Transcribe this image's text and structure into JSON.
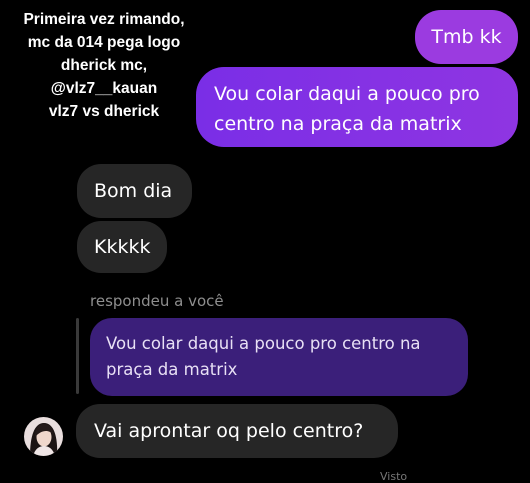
{
  "caption": {
    "lines": [
      "Primeira vez rimando,",
      "mc da 014 pega logo",
      "dherick mc,",
      "@vlz7__kauan",
      "vlz7 vs dherick"
    ]
  },
  "messages": {
    "outgoing": [
      {
        "text": "Tmb kk"
      },
      {
        "text_line1": "Vou colar daqui a pouco pro",
        "text_line2": "centro na praça da matrix"
      }
    ],
    "incoming": [
      {
        "text": "Bom dia"
      },
      {
        "text": "Kkkkk"
      },
      {
        "text": "Vai aprontar oq pelo centro?"
      }
    ]
  },
  "reply": {
    "label": "respondeu a você",
    "quoted_line1": "Vou colar daqui a pouco pro centro na",
    "quoted_line2": "praça da matrix"
  },
  "footer": {
    "partial_text": "Visto"
  },
  "colors": {
    "background": "#000000",
    "outgoing_bubble": "#8f35e2",
    "incoming_bubble": "#262626",
    "quoted_bubble": "#3b1f7a",
    "meta_text": "#8e8e8e"
  },
  "icons": {
    "avatar": "user-avatar"
  }
}
